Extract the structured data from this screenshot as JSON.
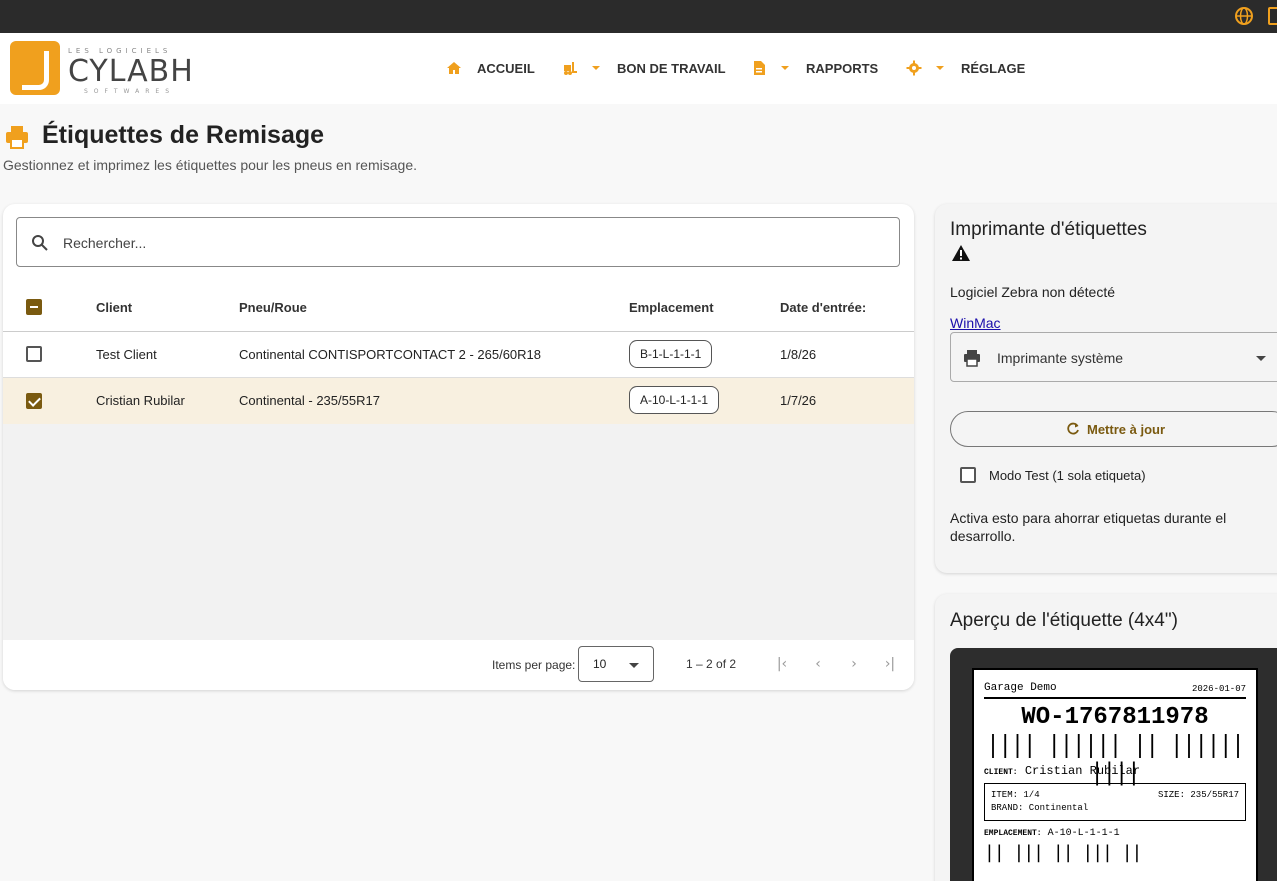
{
  "nav": {
    "logo_small": "LES LOGICIELS",
    "logo_big": "CYLABH",
    "logo_sub": "SOFTWARES",
    "items": [
      {
        "label": "ACCUEIL",
        "icon": "home-icon"
      },
      {
        "label": "BON DE TRAVAIL",
        "icon": "forklift-icon"
      },
      {
        "label": "RAPPORTS",
        "icon": "report-file-icon"
      },
      {
        "label": "RÉGLAGE",
        "icon": "gear-icon"
      }
    ]
  },
  "header": {
    "title": "Étiquettes de Remisage",
    "subtitle": "Gestionnez et imprimez les étiquettes pour les pneus en remisage."
  },
  "search": {
    "placeholder": "Rechercher..."
  },
  "table": {
    "columns": [
      "Client",
      "Pneu/Roue",
      "Emplacement",
      "Date d'entrée:"
    ],
    "rows": [
      {
        "client": "Test Client",
        "tire": "Continental CONTISPORTCONTACT 2 - 265/60R18",
        "location": "B-1-L-1-1-1",
        "date": "1/8/26",
        "selected": false
      },
      {
        "client": "Cristian Rubilar",
        "tire": "Continental - 235/55R17",
        "location": "A-10-L-1-1-1",
        "date": "1/7/26",
        "selected": true
      }
    ]
  },
  "paginator": {
    "items_label": "Items per page:",
    "page_size": "10",
    "range": "1 – 2 of 2"
  },
  "printer": {
    "title": "Imprimante d'étiquettes",
    "status": "Logiciel Zebra non détecté",
    "link": "WinMac",
    "select_value": "Imprimante système",
    "refresh_label": "Mettre à jour",
    "test_label": "Modo Test (1 sola etiqueta)",
    "test_help": "Activa esto para ahorrar etiquetas durante el desarrollo."
  },
  "preview": {
    "title": "Aperçu de l'étiquette (4x4\")",
    "garage": "Garage Demo",
    "date": "2026-01-07",
    "wo": "WO-1767811978",
    "barcode": "|||| |||||| || |||||| ||||",
    "client_key": "CLIENT:",
    "client": "Cristian Rubilar",
    "item": "ITEM: 1/4",
    "size": "SIZE: 235/55R17",
    "brand": "BRAND: Continental",
    "emp_key": "EMPLACEMENT:",
    "emp": "A-10-L-1-1-1",
    "barcode2": "|| ||| || ||| ||"
  },
  "colors": {
    "accent": "#f0a01e",
    "brown": "#7a5a10",
    "selected_row": "#f8f0e0"
  }
}
